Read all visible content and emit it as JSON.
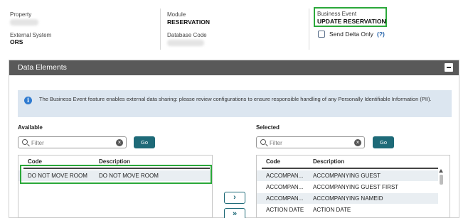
{
  "header": {
    "property_label": "Property",
    "external_system_label": "External System",
    "external_system_value": "ORS",
    "module_label": "Module",
    "module_value": "RESERVATION",
    "database_code_label": "Database Code",
    "business_event_label": "Business Event",
    "business_event_value": "UPDATE RESERVATION",
    "send_delta_label": "Send Delta Only",
    "help_label": "(?)"
  },
  "panel": {
    "title": "Data Elements",
    "info_text": "The Business Event feature enables external data sharing: please review configurations to ensure responsible handling of any Personally Identifiable Information (PII)."
  },
  "available": {
    "label": "Available",
    "filter_placeholder": "Filter",
    "go_label": "Go",
    "col_code": "Code",
    "col_desc": "Description",
    "rows": [
      {
        "code": "DO NOT MOVE ROOM",
        "desc": "DO NOT MOVE ROOM"
      }
    ]
  },
  "selected": {
    "label": "Selected",
    "filter_placeholder": "Filter",
    "go_label": "Go",
    "col_code": "Code",
    "col_desc": "Description",
    "rows": [
      {
        "code": "ACCOMPAN...",
        "desc": "ACCOMPANYING GUEST"
      },
      {
        "code": "ACCOMPAN...",
        "desc": "ACCOMPANYING GUEST FIRST"
      },
      {
        "code": "ACCOMPAN...",
        "desc": "ACCOMPANYING NAMEID"
      },
      {
        "code": "ACTION DATE",
        "desc": "ACTION DATE"
      }
    ]
  },
  "move_buttons": {
    "move_one": "›",
    "move_all": "»"
  },
  "colors": {
    "accent": "#1e6a78",
    "highlight": "#2aa83a",
    "panel_header": "#595959"
  }
}
